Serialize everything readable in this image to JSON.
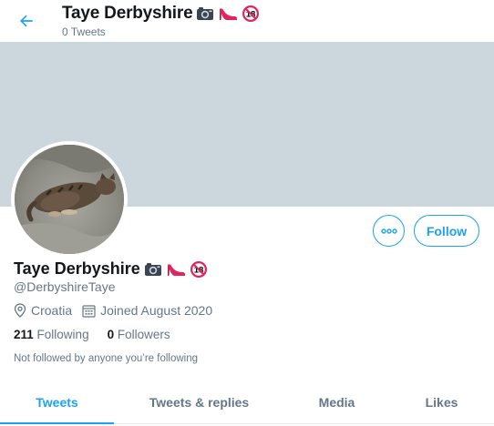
{
  "header": {
    "name": "Taye Derbyshire",
    "tweet_count": "0 Tweets",
    "emoji": [
      "camera-icon",
      "high-heel-icon",
      "no-under-18-icon"
    ]
  },
  "profile": {
    "name": "Taye Derbyshire",
    "handle": "@DerbyshireTaye",
    "location": "Croatia",
    "joined": "Joined August 2020",
    "following_count": "211",
    "following_label": "Following",
    "followers_count": "0",
    "followers_label": "Followers",
    "followed_note": "Not followed by anyone you’re following"
  },
  "actions": {
    "follow_label": "Follow"
  },
  "tabs": [
    {
      "label": "Tweets",
      "active": true
    },
    {
      "label": "Tweets & replies",
      "active": false
    },
    {
      "label": "Media",
      "active": false
    },
    {
      "label": "Likes",
      "active": false
    }
  ],
  "colors": {
    "accent": "#1da1f2",
    "banner": "#ccd6dd",
    "secondary_text": "#657786"
  }
}
